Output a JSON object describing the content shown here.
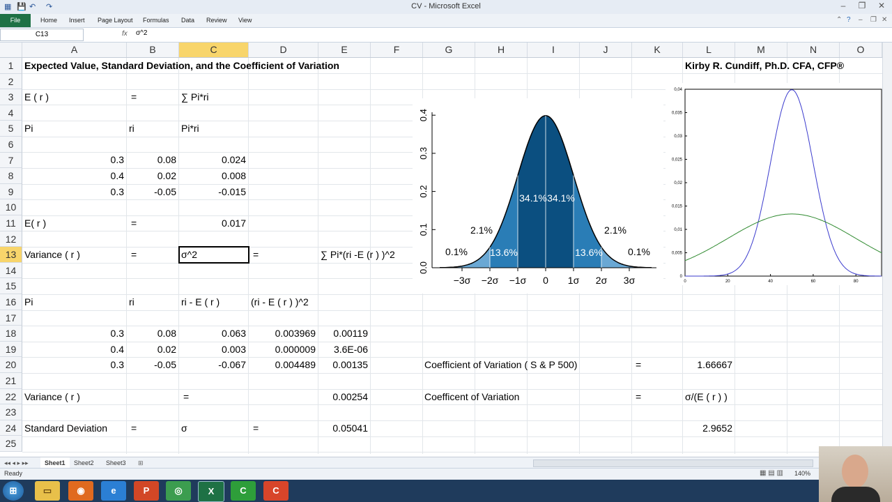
{
  "window": {
    "title": "CV - Microsoft Excel"
  },
  "ribbon": {
    "file": "File",
    "tabs": [
      "Home",
      "Insert",
      "Page Layout",
      "Formulas",
      "Data",
      "Review",
      "View"
    ]
  },
  "formula_bar": {
    "name_box": "C13",
    "fx": "fx",
    "formula": "σ^2"
  },
  "columns": [
    "A",
    "B",
    "C",
    "D",
    "E",
    "F",
    "G",
    "H",
    "I",
    "J",
    "K",
    "L",
    "M",
    "N",
    "O"
  ],
  "rows": [
    "1",
    "2",
    "3",
    "4",
    "5",
    "6",
    "7",
    "8",
    "9",
    "10",
    "11",
    "12",
    "13",
    "14",
    "15",
    "16",
    "17",
    "18",
    "19",
    "20",
    "21",
    "22",
    "23",
    "24",
    "25"
  ],
  "cells": {
    "A1": "Expected Value, Standard Deviation, and the Coefficient of Variation",
    "L1": "Kirby R. Cundiff, Ph.D. CFA, CFP®",
    "A3": "E ( r )",
    "B3": "=",
    "C3": "∑ Pi*ri",
    "A5": "Pi",
    "B5": "ri",
    "C5": "Pi*ri",
    "A7": "0.3",
    "B7": "0.08",
    "C7": "0.024",
    "A8": "0.4",
    "B8": "0.02",
    "C8": "0.008",
    "A9": "0.3",
    "B9": "-0.05",
    "C9": "-0.015",
    "A11": "E(  r  )",
    "B11": "=",
    "C11": "0.017",
    "A13": "Variance  ( r )",
    "B13": "=",
    "C13": "σ^2",
    "D13": "=",
    "E13": "∑ Pi*(ri -E (r ) )^2",
    "A16": "Pi",
    "B16": "ri",
    "C16": "ri - E ( r )",
    "D16": "(ri - E ( r ) )^2",
    "A18": "0.3",
    "B18": "0.08",
    "C18": "0.063",
    "D18": "0.003969",
    "E18": "0.00119",
    "A19": "0.4",
    "B19": "0.02",
    "C19": "0.003",
    "D19": "0.000009",
    "E19": "3.6E-06",
    "A20": "0.3",
    "B20": "-0.05",
    "C20": "-0.067",
    "D20": "0.004489",
    "E20": "0.00135",
    "G20": "Coefficient of Variation ( S & P 500)",
    "K20": "=",
    "L20": "1.66667",
    "A22": "Variance  ( r )",
    "C22": "=",
    "E22": "0.00254",
    "G22": "Coefficent of Variation",
    "K22": "=",
    "L22": "σ/(E ( r ) )",
    "A24": "Standard Deviation",
    "B24": "=",
    "C24": "σ",
    "D24": "=",
    "E24": "0.05041",
    "L24": "2.9652"
  },
  "sheets": [
    "Sheet1",
    "Sheet2",
    "Sheet3"
  ],
  "status": {
    "ready": "Ready",
    "zoom": "140%"
  },
  "normal_chart": {
    "y_ticks": [
      "0.0",
      "0.1",
      "0.2",
      "0.3",
      "0.4"
    ],
    "x_ticks": [
      "−3σ",
      "−2σ",
      "−1σ",
      "0",
      "1σ",
      "2σ",
      "3σ"
    ],
    "labels": [
      "0.1%",
      "2.1%",
      "13.6%",
      "34.1%",
      "34.1%",
      "13.6%",
      "2.1%",
      "0.1%"
    ],
    "colors": {
      "inner": "#0b4f80",
      "middle": "#2a7db6",
      "outer": "#6aa8d4"
    }
  },
  "dist_chart": {
    "y_ticks": [
      "0",
      "0,005",
      "0,01",
      "0,015",
      "0,02",
      "0,025",
      "0,03",
      "0,035",
      "0,04"
    ],
    "x_ticks": [
      "0",
      "20",
      "40",
      "60",
      "80"
    ],
    "series_colors": [
      "#3a3acd",
      "#2f8a2f"
    ]
  },
  "taskbar": {
    "apps": [
      "start-orb",
      "explorer",
      "firefox",
      "internet-explorer",
      "powerpoint",
      "chrome",
      "excel",
      "camtasia-recorder",
      "camtasia-studio"
    ]
  }
}
